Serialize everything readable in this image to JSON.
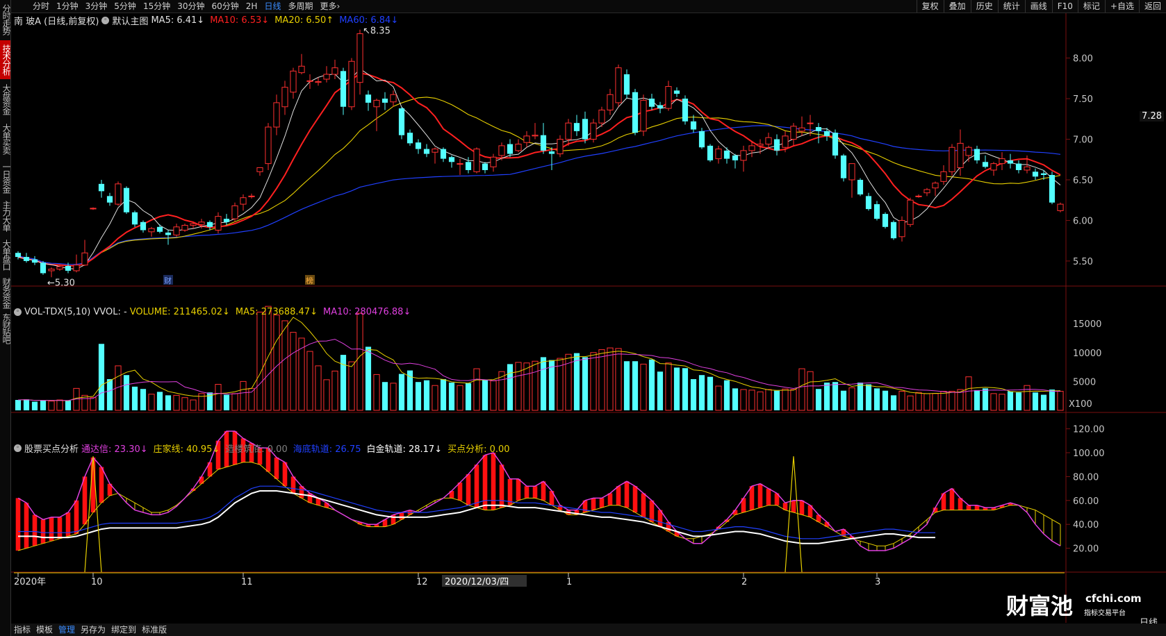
{
  "toolbar": {
    "periods": [
      "分时",
      "1分钟",
      "3分钟",
      "5分钟",
      "15分钟",
      "30分钟",
      "60分钟",
      "2H",
      "日线",
      "多周期",
      "更多›"
    ],
    "active_period": "日线",
    "right_buttons": [
      "复权",
      "叠加",
      "历史",
      "统计",
      "画线",
      "F10",
      "标记",
      "+自选",
      "返回"
    ]
  },
  "left_nav": {
    "tabs": [
      "分时走势",
      "技术分析",
      "大盘资金",
      "大单买卖",
      "一日资金",
      "主力大单",
      "大单盘口",
      "财务资金",
      "东财贴吧"
    ],
    "active": "技术分析"
  },
  "main_panel": {
    "stock": "南 玻A (日线,前复权)",
    "indicator": "默认主图",
    "ma_items": [
      {
        "label": "MA5: 6.41↓",
        "color": "#e0e0e0"
      },
      {
        "label": "MA10: 6.53↓",
        "color": "#ff2020"
      },
      {
        "label": "MA20: 6.50↑",
        "color": "#e8d000"
      },
      {
        "label": "MA60: 6.84↓",
        "color": "#2040ff"
      }
    ],
    "price_ticks": [
      "8.00",
      "7.50",
      "7.00",
      "6.50",
      "6.00",
      "5.50"
    ],
    "current_price": "7.28",
    "high_label": "8.35",
    "low_label": "5.30",
    "markers": [
      "财",
      "榜"
    ]
  },
  "volume_panel": {
    "title": "VOL-TDX(5,10) VVOL: -",
    "items": [
      {
        "label": "VOLUME: 211465.02↓",
        "color": "#e8d000"
      },
      {
        "label": "MA5: 273688.47↓",
        "color": "#e8d000"
      },
      {
        "label": "MA10: 280476.88↓",
        "color": "#e040e0"
      }
    ],
    "ticks": [
      "15000",
      "10000",
      "5000"
    ],
    "unit": "X100"
  },
  "buy_panel": {
    "title": "股票买点分析",
    "items": [
      {
        "label": "通达信: 23.30↓",
        "color": "#e040e0"
      },
      {
        "label": "庄家线: 40.95↓",
        "color": "#e8d000"
      },
      {
        "label": "造楼筑底: 0.00",
        "color": "#808080"
      },
      {
        "label": "海底轨道: 26.75",
        "color": "#2040ff"
      },
      {
        "label": "白金轨道: 28.17↓",
        "color": "#ffffff"
      },
      {
        "label": "买点分析: 0.00",
        "color": "#e8d000"
      }
    ],
    "ticks": [
      "120.00",
      "100.00",
      "80.00",
      "60.00",
      "40.00",
      "20.00"
    ]
  },
  "date_axis": {
    "labels": [
      "2020年",
      "10",
      "11",
      "12",
      "1",
      "2",
      "3"
    ],
    "cursor_date": "2020/12/03/四",
    "period_label": "日线"
  },
  "bottom_bar": {
    "buttons": [
      "指标",
      "模板",
      "管理",
      "另存为",
      "绑定到",
      "标准版"
    ],
    "active": "管理"
  },
  "logo": {
    "text": "财富池",
    "domain": "cfchi.com",
    "slogan": "指标交易平台"
  },
  "colors": {
    "up": "#ff3030",
    "down": "#54ffff",
    "ma5": "#e0e0e0",
    "ma10": "#ff2020",
    "ma20": "#e8d000",
    "ma60": "#2040ff",
    "background": "#000000"
  },
  "chart_data": {
    "type": "candlestick",
    "price_range": [
      5.2,
      8.45
    ],
    "volume_range": [
      0,
      18500
    ],
    "indicator_range": [
      0,
      125
    ],
    "candles": [
      [
        5.6,
        5.62,
        5.52,
        5.55,
        1800
      ],
      [
        5.55,
        5.6,
        5.48,
        5.5,
        1900
      ],
      [
        5.52,
        5.56,
        5.45,
        5.48,
        1500
      ],
      [
        5.48,
        5.5,
        5.33,
        5.35,
        1700
      ],
      [
        5.38,
        5.42,
        5.3,
        5.4,
        1600
      ],
      [
        5.4,
        5.46,
        5.38,
        5.43,
        1800
      ],
      [
        5.44,
        5.48,
        5.35,
        5.38,
        1700
      ],
      [
        5.38,
        5.58,
        5.36,
        5.45,
        3800
      ],
      [
        5.45,
        5.76,
        5.44,
        5.6,
        2600
      ],
      [
        6.15,
        6.16,
        6.13,
        6.15,
        2200
      ],
      [
        6.45,
        6.5,
        6.28,
        6.36,
        11500
      ],
      [
        6.3,
        6.34,
        6.18,
        6.22,
        5400
      ],
      [
        6.2,
        6.48,
        6.18,
        6.45,
        7700
      ],
      [
        6.4,
        6.42,
        6.08,
        6.1,
        6100
      ],
      [
        6.1,
        6.12,
        5.92,
        5.95,
        4100
      ],
      [
        5.98,
        6.0,
        5.85,
        5.88,
        3700
      ],
      [
        5.86,
        5.92,
        5.8,
        5.9,
        2800
      ],
      [
        5.92,
        5.95,
        5.84,
        5.86,
        3200
      ],
      [
        5.85,
        5.88,
        5.7,
        5.82,
        2600
      ],
      [
        5.82,
        5.96,
        5.8,
        5.92,
        2600
      ],
      [
        5.88,
        5.96,
        5.86,
        5.94,
        2200
      ],
      [
        5.94,
        5.98,
        5.9,
        5.96,
        1800
      ],
      [
        5.95,
        6.02,
        5.9,
        5.98,
        2900
      ],
      [
        5.98,
        6.0,
        5.88,
        5.92,
        3100
      ],
      [
        5.88,
        6.1,
        5.84,
        6.05,
        4500
      ],
      [
        6.02,
        6.08,
        5.94,
        5.98,
        2700
      ],
      [
        6.02,
        6.22,
        5.98,
        6.18,
        2900
      ],
      [
        6.2,
        6.32,
        6.12,
        6.28,
        5000
      ],
      [
        6.3,
        6.33,
        6.27,
        6.3,
        3800
      ],
      [
        6.6,
        6.65,
        6.55,
        6.65,
        17000
      ],
      [
        6.7,
        7.2,
        6.62,
        7.15,
        18000
      ],
      [
        7.15,
        7.55,
        7.05,
        7.45,
        16500
      ],
      [
        7.4,
        7.72,
        7.3,
        7.64,
        15500
      ],
      [
        7.58,
        7.88,
        7.5,
        7.84,
        13500
      ],
      [
        7.82,
        8.05,
        7.8,
        7.9,
        12500
      ],
      [
        7.72,
        7.8,
        7.62,
        7.72,
        10200
      ],
      [
        7.7,
        7.76,
        7.66,
        7.71,
        7700
      ],
      [
        7.74,
        7.9,
        7.7,
        7.8,
        5300
      ],
      [
        7.8,
        7.98,
        7.74,
        7.88,
        6800
      ],
      [
        7.84,
        7.88,
        7.3,
        7.4,
        9600
      ],
      [
        7.4,
        8.0,
        7.36,
        7.96,
        8400
      ],
      [
        7.7,
        8.35,
        7.55,
        8.3,
        16800
      ],
      [
        7.55,
        7.6,
        7.35,
        7.45,
        11000
      ],
      [
        7.4,
        7.5,
        7.1,
        7.48,
        6200
      ],
      [
        7.5,
        7.58,
        7.36,
        7.45,
        4900
      ],
      [
        7.46,
        7.6,
        7.4,
        7.55,
        4700
      ],
      [
        7.38,
        7.4,
        7.0,
        7.05,
        6300
      ],
      [
        7.08,
        7.12,
        6.92,
        6.95,
        6900
      ],
      [
        6.96,
        7.0,
        6.82,
        6.88,
        4900
      ],
      [
        6.88,
        6.94,
        6.78,
        6.82,
        5200
      ],
      [
        6.84,
        6.9,
        6.7,
        6.88,
        4300
      ],
      [
        6.88,
        6.9,
        6.72,
        6.76,
        5400
      ],
      [
        6.78,
        6.8,
        6.65,
        6.72,
        4800
      ],
      [
        6.7,
        6.76,
        6.56,
        6.7,
        4300
      ],
      [
        6.72,
        6.78,
        6.58,
        6.62,
        4700
      ],
      [
        6.6,
        6.9,
        6.58,
        6.88,
        7200
      ],
      [
        6.7,
        6.72,
        6.58,
        6.62,
        5300
      ],
      [
        6.66,
        6.82,
        6.6,
        6.78,
        5100
      ],
      [
        6.8,
        6.96,
        6.74,
        6.92,
        6700
      ],
      [
        6.94,
        7.0,
        6.78,
        6.82,
        8000
      ],
      [
        6.86,
        7.0,
        6.84,
        6.94,
        8300
      ],
      [
        6.96,
        7.1,
        6.9,
        7.04,
        8200
      ],
      [
        7.04,
        7.2,
        7.0,
        7.05,
        8500
      ],
      [
        7.05,
        7.2,
        6.82,
        6.86,
        9200
      ],
      [
        6.85,
        6.9,
        6.62,
        6.82,
        8700
      ],
      [
        6.82,
        7.05,
        6.78,
        7.0,
        9000
      ],
      [
        7.0,
        7.25,
        6.92,
        7.2,
        9700
      ],
      [
        7.2,
        7.3,
        7.04,
        7.1,
        9900
      ],
      [
        7.25,
        7.34,
        6.95,
        7.0,
        9200
      ],
      [
        7.0,
        7.25,
        6.96,
        7.2,
        10000
      ],
      [
        7.2,
        7.4,
        7.15,
        7.36,
        10500
      ],
      [
        7.36,
        7.62,
        7.3,
        7.55,
        10800
      ],
      [
        7.45,
        7.92,
        7.4,
        7.88,
        10700
      ],
      [
        7.8,
        7.86,
        7.5,
        7.55,
        8500
      ],
      [
        7.58,
        7.62,
        7.05,
        7.08,
        8500
      ],
      [
        7.1,
        7.55,
        7.04,
        7.48,
        8000
      ],
      [
        7.5,
        7.56,
        7.36,
        7.4,
        8800
      ],
      [
        7.42,
        7.46,
        7.32,
        7.38,
        6700
      ],
      [
        7.38,
        7.72,
        7.35,
        7.65,
        8200
      ],
      [
        7.6,
        7.64,
        7.52,
        7.56,
        7400
      ],
      [
        7.5,
        7.54,
        7.18,
        7.22,
        7300
      ],
      [
        7.22,
        7.3,
        7.08,
        7.12,
        5400
      ],
      [
        7.1,
        7.14,
        6.88,
        6.9,
        6100
      ],
      [
        6.92,
        6.94,
        6.72,
        6.74,
        5800
      ],
      [
        6.76,
        6.92,
        6.7,
        6.88,
        4200
      ],
      [
        6.86,
        6.9,
        6.7,
        6.76,
        5200
      ],
      [
        6.8,
        6.82,
        6.64,
        6.74,
        3800
      ],
      [
        6.74,
        6.92,
        6.6,
        6.86,
        3600
      ],
      [
        6.86,
        6.98,
        6.78,
        6.92,
        3500
      ],
      [
        6.92,
        7.0,
        6.82,
        6.94,
        3200
      ],
      [
        6.94,
        7.08,
        6.88,
        7.02,
        3600
      ],
      [
        7.0,
        7.06,
        6.8,
        6.86,
        3400
      ],
      [
        6.9,
        7.1,
        6.84,
        7.04,
        3700
      ],
      [
        7.0,
        7.2,
        6.92,
        7.16,
        3600
      ],
      [
        7.1,
        7.28,
        7.04,
        7.14,
        7200
      ],
      [
        7.2,
        7.3,
        7.04,
        7.2,
        6700
      ],
      [
        7.15,
        7.2,
        6.95,
        7.1,
        3700
      ],
      [
        7.1,
        7.14,
        6.98,
        7.04,
        4800
      ],
      [
        7.08,
        7.12,
        6.76,
        6.8,
        4900
      ],
      [
        6.8,
        6.82,
        6.48,
        6.52,
        3400
      ],
      [
        6.5,
        6.54,
        6.28,
        6.7,
        3900
      ],
      [
        6.5,
        6.52,
        6.3,
        6.32,
        4800
      ],
      [
        6.3,
        6.34,
        6.12,
        6.14,
        4500
      ],
      [
        6.2,
        6.24,
        6.0,
        6.02,
        3800
      ],
      [
        6.08,
        6.1,
        5.9,
        5.92,
        3400
      ],
      [
        5.98,
        6.0,
        5.76,
        5.78,
        2600
      ],
      [
        5.8,
        6.05,
        5.74,
        6.0,
        3300
      ],
      [
        5.95,
        6.28,
        5.92,
        6.25,
        2500
      ],
      [
        6.3,
        6.32,
        6.28,
        6.3,
        3100
      ],
      [
        6.34,
        6.4,
        6.3,
        6.38,
        2900
      ],
      [
        6.4,
        6.48,
        6.3,
        6.46,
        2900
      ],
      [
        6.48,
        6.68,
        6.44,
        6.6,
        3300
      ],
      [
        6.6,
        6.94,
        6.55,
        6.9,
        3300
      ],
      [
        6.65,
        7.12,
        6.55,
        6.95,
        3600
      ],
      [
        6.8,
        6.92,
        6.72,
        6.9,
        5800
      ],
      [
        6.88,
        6.92,
        6.7,
        6.74,
        3500
      ],
      [
        6.72,
        6.8,
        6.64,
        6.66,
        3800
      ],
      [
        6.62,
        6.72,
        6.55,
        6.7,
        2900
      ],
      [
        6.7,
        6.84,
        6.62,
        6.76,
        2800
      ],
      [
        6.74,
        6.82,
        6.64,
        6.7,
        3300
      ],
      [
        6.7,
        6.74,
        6.58,
        6.62,
        3100
      ],
      [
        6.62,
        6.8,
        6.58,
        6.66,
        4300
      ],
      [
        6.6,
        6.64,
        6.5,
        6.54,
        3100
      ],
      [
        6.58,
        6.62,
        6.5,
        6.56,
        2700
      ],
      [
        6.56,
        6.6,
        6.2,
        6.22,
        3600
      ],
      [
        6.12,
        6.22,
        6.1,
        6.2,
        3300
      ]
    ],
    "ma_periods": {
      "ma5": 5,
      "ma10": 10,
      "ma20": 20,
      "ma60": 60
    },
    "indicator": {
      "tongdaxin": [
        62,
        58,
        48,
        44,
        46,
        46,
        50,
        60,
        80,
        96,
        88,
        74,
        66,
        58,
        52,
        50,
        48,
        48,
        50,
        55,
        62,
        70,
        80,
        92,
        110,
        118,
        118,
        112,
        108,
        104,
        104,
        96,
        92,
        80,
        72,
        66,
        62,
        58,
        52,
        48,
        44,
        42,
        40,
        40,
        44,
        48,
        50,
        52,
        50,
        54,
        58,
        62,
        68,
        75,
        82,
        90,
        98,
        100,
        90,
        78,
        78,
        72,
        72,
        76,
        68,
        56,
        52,
        52,
        60,
        62,
        62,
        66,
        72,
        76,
        72,
        66,
        60,
        52,
        42,
        34,
        28,
        24,
        24,
        30,
        38,
        44,
        52,
        62,
        72,
        74,
        70,
        66,
        58,
        60,
        60,
        56,
        48,
        42,
        34,
        36,
        30,
        22,
        18,
        18,
        18,
        20,
        24,
        28,
        34,
        40,
        54,
        66,
        70,
        62,
        56,
        56,
        54,
        54,
        56,
        58,
        56,
        50,
        40,
        32,
        26,
        22
      ],
      "zhuangjia": [
        18,
        20,
        22,
        24,
        26,
        28,
        30,
        32,
        40,
        50,
        58,
        64,
        66,
        62,
        58,
        54,
        50,
        50,
        52,
        56,
        62,
        68,
        74,
        80,
        86,
        88,
        90,
        92,
        92,
        90,
        84,
        78,
        72,
        66,
        62,
        58,
        56,
        54,
        52,
        48,
        44,
        40,
        38,
        38,
        38,
        40,
        44,
        48,
        52,
        56,
        60,
        62,
        62,
        60,
        56,
        54,
        52,
        52,
        54,
        56,
        60,
        62,
        62,
        60,
        56,
        52,
        48,
        48,
        50,
        52,
        54,
        56,
        56,
        54,
        50,
        46,
        42,
        38,
        34,
        30,
        28,
        28,
        30,
        32,
        36,
        42,
        48,
        50,
        52,
        54,
        56,
        56,
        52,
        50,
        48,
        46,
        42,
        38,
        34,
        30,
        28,
        26,
        24,
        22,
        22,
        24,
        28,
        32,
        38,
        44,
        50,
        52,
        52,
        52,
        52,
        52,
        52,
        52,
        54,
        56,
        56,
        54,
        52,
        48,
        44,
        40
      ],
      "bottom_track": [
        28,
        28,
        28,
        27,
        27,
        27,
        27,
        28,
        30,
        32,
        34,
        35,
        35,
        35,
        35,
        35,
        35,
        35,
        35,
        35,
        36,
        37,
        38,
        40,
        44,
        50,
        56,
        60,
        64,
        66,
        66,
        66,
        65,
        64,
        63,
        62,
        60,
        58,
        56,
        54,
        52,
        50,
        48,
        46,
        45,
        44,
        44,
        44,
        44,
        44,
        45,
        46,
        47,
        48,
        50,
        52,
        54,
        54,
        54,
        53,
        52,
        52,
        52,
        51,
        50,
        49,
        48,
        47,
        46,
        45,
        44,
        44,
        43,
        42,
        41,
        40,
        38,
        36,
        34,
        32,
        30,
        28,
        28,
        29,
        30,
        31,
        32,
        32,
        31,
        30,
        28,
        26,
        24,
        23,
        22,
        22,
        22,
        23,
        24,
        25,
        26,
        27,
        28,
        29,
        30,
        30,
        29,
        28,
        27,
        27,
        27
      ]
    }
  }
}
